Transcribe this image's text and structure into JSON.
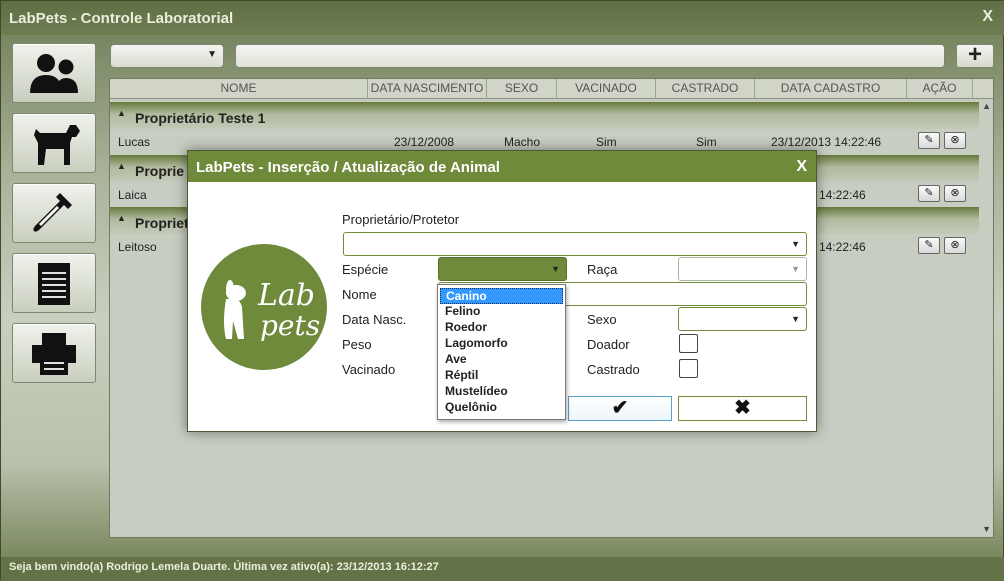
{
  "window": {
    "title": "LabPets - Controle Laboratorial",
    "close_glyph": "X"
  },
  "sidebar": {
    "items": [
      {
        "icon": "owners-icon"
      },
      {
        "icon": "dog-icon"
      },
      {
        "icon": "dropper-icon"
      },
      {
        "icon": "notepad-icon"
      },
      {
        "icon": "printer-icon"
      }
    ]
  },
  "toolbar": {
    "filter_value": "",
    "filter_arrow": "▼",
    "search_value": "",
    "add_label": "+"
  },
  "grid": {
    "columns": [
      "NOME",
      "DATA NASCIMENTO",
      "SEXO",
      "VACINADO",
      "CASTRADO",
      "DATA CADASTRO",
      "AÇÃO"
    ],
    "groups": [
      {
        "name": "Proprietário Teste 1",
        "rows": [
          {
            "nome": "Lucas",
            "nascimento": "23/12/2008",
            "sexo": "Macho",
            "vacinado": "Sim",
            "castrado": "Sim",
            "cadastro": "23/12/2013 14:22:46"
          }
        ]
      },
      {
        "name": "Proprie",
        "rows": [
          {
            "nome": "Laica",
            "nascimento": "",
            "sexo": "",
            "vacinado": "",
            "castrado": "",
            "cadastro": "14:22:46"
          }
        ]
      },
      {
        "name": "Propriet",
        "rows": [
          {
            "nome": "Leitoso",
            "nascimento": "",
            "sexo": "",
            "vacinado": "",
            "castrado": "",
            "cadastro": "14:22:46"
          }
        ]
      }
    ],
    "edit_glyph": "✎",
    "delete_glyph": "⊗",
    "caret_glyph": "▲"
  },
  "status": {
    "text": "Seja bem vindo(a) Rodrigo Lemela Duarte. Última vez ativo(a): 23/12/2013 16:12:27"
  },
  "dialog": {
    "title": "LabPets - Inserção / Atualização de Animal",
    "close_glyph": "X",
    "logo_text_top": "Lab",
    "logo_text_bottom": "pets",
    "labels": {
      "proprietario": "Proprietário/Protetor",
      "especie": "Espécie",
      "raca": "Raça",
      "nome": "Nome",
      "data_nasc": "Data Nasc.",
      "sexo": "Sexo",
      "peso": "Peso",
      "doador": "Doador",
      "vacinado": "Vacinado",
      "castrado": "Castrado"
    },
    "values": {
      "proprietario": "",
      "especie": "",
      "raca": "",
      "nome": "",
      "sexo": ""
    },
    "arrow_glyph": "▼",
    "ok_glyph": "✔",
    "cancel_glyph": "✖",
    "especie_options": [
      "Canino",
      "Felino",
      "Roedor",
      "Lagomorfo",
      "Ave",
      "Réptil",
      "Mustelídeo",
      "Quelônio"
    ],
    "especie_highlighted": "Canino"
  },
  "colors": {
    "accent": "#6f8a3a",
    "title_bar": "#6b7a4d",
    "selection": "#3399ff"
  }
}
